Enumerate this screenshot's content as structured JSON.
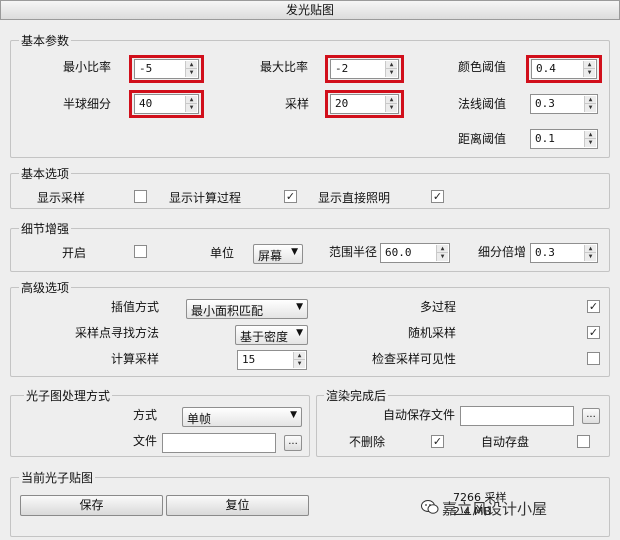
{
  "window": {
    "title": "发光贴图"
  },
  "basic_params": {
    "title": "基本参数",
    "min_rate": {
      "label": "最小比率",
      "value": "-5"
    },
    "max_rate": {
      "label": "最大比率",
      "value": "-2"
    },
    "color_thresh": {
      "label": "颜色阈值",
      "value": "0.4"
    },
    "hemi_subdiv": {
      "label": "半球细分",
      "value": "40"
    },
    "samples": {
      "label": "采样",
      "value": "20"
    },
    "normal_thresh": {
      "label": "法线阈值",
      "value": "0.3"
    },
    "dist_thresh": {
      "label": "距离阈值",
      "value": "0.1"
    }
  },
  "basic_options": {
    "title": "基本选项",
    "show_samples": {
      "label": "显示采样",
      "checked": false
    },
    "show_calc": {
      "label": "显示计算过程",
      "checked": true
    },
    "show_direct": {
      "label": "显示直接照明",
      "checked": true
    }
  },
  "detail": {
    "title": "细节增强",
    "enable": {
      "label": "开启",
      "checked": false
    },
    "unit_label": "单位",
    "unit_value": "屏幕",
    "radius_label": "范围半径",
    "radius_value": "60.0",
    "subdiv_mult_label": "细分倍增",
    "subdiv_mult_value": "0.3"
  },
  "advanced": {
    "title": "高级选项",
    "interp_label": "插值方式",
    "interp_value": "最小面积匹配",
    "lookup_label": "采样点寻找方法",
    "lookup_value": "基于密度",
    "calc_samples_label": "计算采样",
    "calc_samples_value": "15",
    "multipass": {
      "label": "多过程",
      "checked": true
    },
    "random": {
      "label": "随机采样",
      "checked": true
    },
    "check_vis": {
      "label": "检查采样可见性",
      "checked": false
    }
  },
  "photon_mode": {
    "title": "光子图处理方式",
    "mode_label": "方式",
    "mode_value": "单帧",
    "file_label": "文件",
    "file_value": "",
    "browse": "..."
  },
  "after_render": {
    "title": "渲染完成后",
    "autosave_label": "自动保存文件",
    "autosave_value": "",
    "browse": "...",
    "no_delete": {
      "label": "不删除",
      "checked": true
    },
    "auto_switch": {
      "label": "自动存盘",
      "checked": false
    }
  },
  "current_map": {
    "title": "当前光子贴图",
    "save": "保存",
    "reset": "复位",
    "samples_info": "7266 采样",
    "size_info": "2.4 MB"
  },
  "watermark": {
    "text": "嘉立风设计小屋"
  },
  "colors": {
    "highlight": "#d10f1b",
    "background": "#eeeeee"
  }
}
